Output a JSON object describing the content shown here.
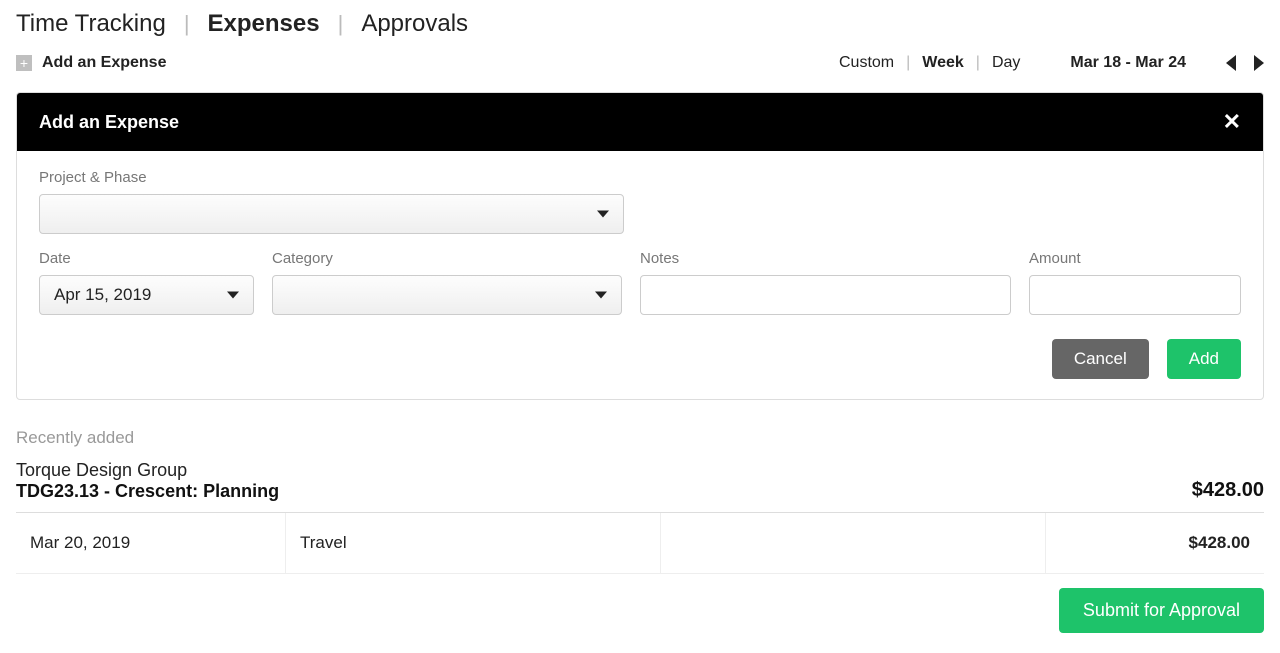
{
  "topTabs": {
    "timeTracking": "Time Tracking",
    "expenses": "Expenses",
    "approvals": "Approvals"
  },
  "addExpenseLink": "Add an Expense",
  "viewSwitch": {
    "custom": "Custom",
    "week": "Week",
    "day": "Day"
  },
  "dateRange": "Mar 18 - Mar 24",
  "panel": {
    "title": "Add an Expense",
    "labels": {
      "projectPhase": "Project & Phase",
      "date": "Date",
      "category": "Category",
      "notes": "Notes",
      "amount": "Amount"
    },
    "dateValue": "Apr 15, 2019",
    "buttons": {
      "cancel": "Cancel",
      "add": "Add"
    }
  },
  "recent": {
    "header": "Recently added",
    "group": {
      "client": "Torque Design Group",
      "project": "TDG23.13 - Crescent: Planning",
      "total": "$428.00"
    },
    "item": {
      "date": "Mar 20, 2019",
      "category": "Travel",
      "amount": "$428.00"
    }
  },
  "submitButton": "Submit for Approval"
}
